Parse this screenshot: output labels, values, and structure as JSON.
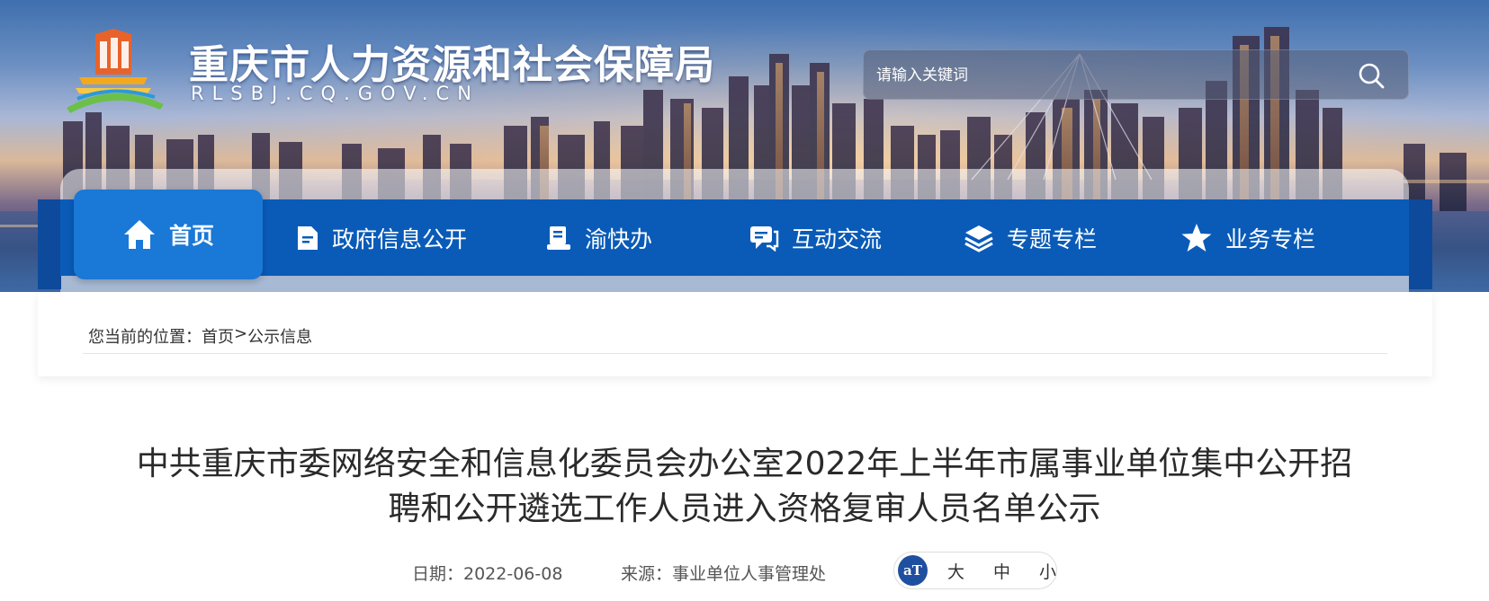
{
  "site": {
    "title": "重庆市人力资源和社会保障局",
    "domain": "RLSBJ.CQ.GOV.CN"
  },
  "search": {
    "placeholder": "请输入关键词"
  },
  "nav": {
    "items": [
      {
        "label": "首页",
        "icon": "home-icon"
      },
      {
        "label": "政府信息公开",
        "icon": "document-icon"
      },
      {
        "label": "渝快办",
        "icon": "desk-icon"
      },
      {
        "label": "互动交流",
        "icon": "chat-icon"
      },
      {
        "label": "专题专栏",
        "icon": "layers-icon"
      },
      {
        "label": "业务专栏",
        "icon": "star-icon"
      }
    ]
  },
  "breadcrumb": {
    "prefix": "您当前的位置：",
    "home": "首页",
    "separator": ">",
    "current": "公示信息"
  },
  "article": {
    "title_line1": "中共重庆市委网络安全和信息化委员会办公室2022年上半年市属事业单位集中公开招",
    "title_line2": "聘和公开遴选工作人员进入资格复审人员名单公示",
    "date": "日期：2022-06-08",
    "source": "来源：事业单位人事管理处"
  },
  "font_size": {
    "icon_text": "aT",
    "large": "大",
    "medium": "中",
    "small": "小"
  },
  "colors": {
    "nav_bg": "#0a5bb8",
    "nav_active": "#1a78d6",
    "font_icon_bg": "#1f4f9f"
  }
}
